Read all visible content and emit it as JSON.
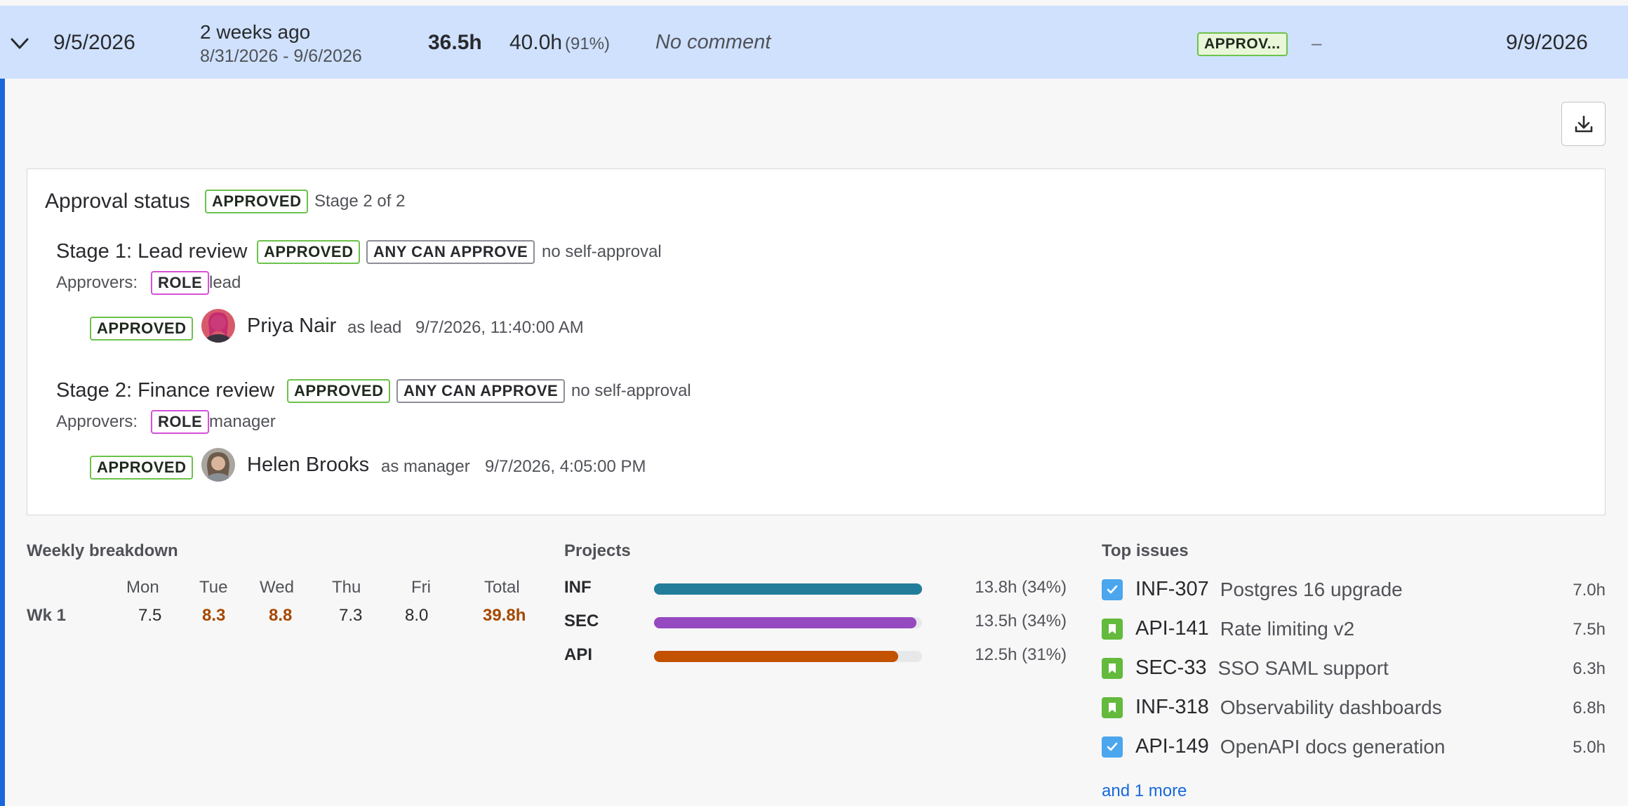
{
  "summary": {
    "date": "9/5/2026",
    "relative": "2 weeks ago",
    "range": "8/31/2026 - 9/6/2026",
    "logged": "36.5h",
    "expected": "40.0h",
    "percent": "(91%)",
    "comment": "No comment",
    "status": "APPROV...",
    "dash": "–",
    "submitted": "9/9/2026"
  },
  "approval": {
    "title": "Approval status",
    "status": "APPROVED",
    "stage_info": "Stage 2 of 2",
    "approvers_label": "Approvers:",
    "stages": [
      {
        "title": "Stage 1: Lead review",
        "status": "APPROVED",
        "rule": "ANY CAN APPROVE",
        "note": "no self-approval",
        "role_tag": "ROLE",
        "role": "lead",
        "decision": "APPROVED",
        "person": "Priya Nair",
        "as": "as lead",
        "time": "9/7/2026, 11:40:00 AM"
      },
      {
        "title": "Stage 2: Finance review",
        "status": "APPROVED",
        "rule": "ANY CAN APPROVE",
        "note": "no self-approval",
        "role_tag": "ROLE",
        "role": "manager",
        "decision": "APPROVED",
        "person": "Helen Brooks",
        "as": "as manager",
        "time": "9/7/2026, 4:05:00 PM"
      }
    ]
  },
  "weekly": {
    "title": "Weekly breakdown",
    "headers": [
      "Mon",
      "Tue",
      "Wed",
      "Thu",
      "Fri",
      "Total"
    ],
    "row_label": "Wk 1",
    "values": [
      "7.5",
      "8.3",
      "8.8",
      "7.3",
      "8.0",
      "39.8h"
    ]
  },
  "projects": {
    "title": "Projects",
    "items": [
      {
        "key": "INF",
        "value": "13.8h (34%)",
        "fill": 1.0,
        "color": "#227d9b"
      },
      {
        "key": "SEC",
        "value": "13.5h (34%)",
        "fill": 0.98,
        "color": "#964ac0"
      },
      {
        "key": "API",
        "value": "12.5h (31%)",
        "fill": 0.91,
        "color": "#c25100"
      }
    ]
  },
  "issues": {
    "title": "Top issues",
    "items": [
      {
        "key": "INF-307",
        "summary": "Postgres 16 upgrade",
        "hours": "7.0h",
        "icon": "task-icon"
      },
      {
        "key": "API-141",
        "summary": "Rate limiting v2",
        "hours": "7.5h",
        "icon": "story-icon"
      },
      {
        "key": "SEC-33",
        "summary": "SSO SAML support",
        "hours": "6.3h",
        "icon": "story-icon"
      },
      {
        "key": "INF-318",
        "summary": "Observability dashboards",
        "hours": "6.8h",
        "icon": "story-icon"
      },
      {
        "key": "API-149",
        "summary": "OpenAPI docs generation",
        "hours": "5.0h",
        "icon": "task-icon"
      }
    ],
    "more": "and 1 more"
  },
  "colors": {
    "row_highlight": "#cfe1fd",
    "accent": "#1868db",
    "approved_border": "#6cc24a",
    "role_border": "#d451d9",
    "highlight_text": "#a54800",
    "task_icon": "#4ba6ee",
    "story_icon": "#63ba3c"
  }
}
